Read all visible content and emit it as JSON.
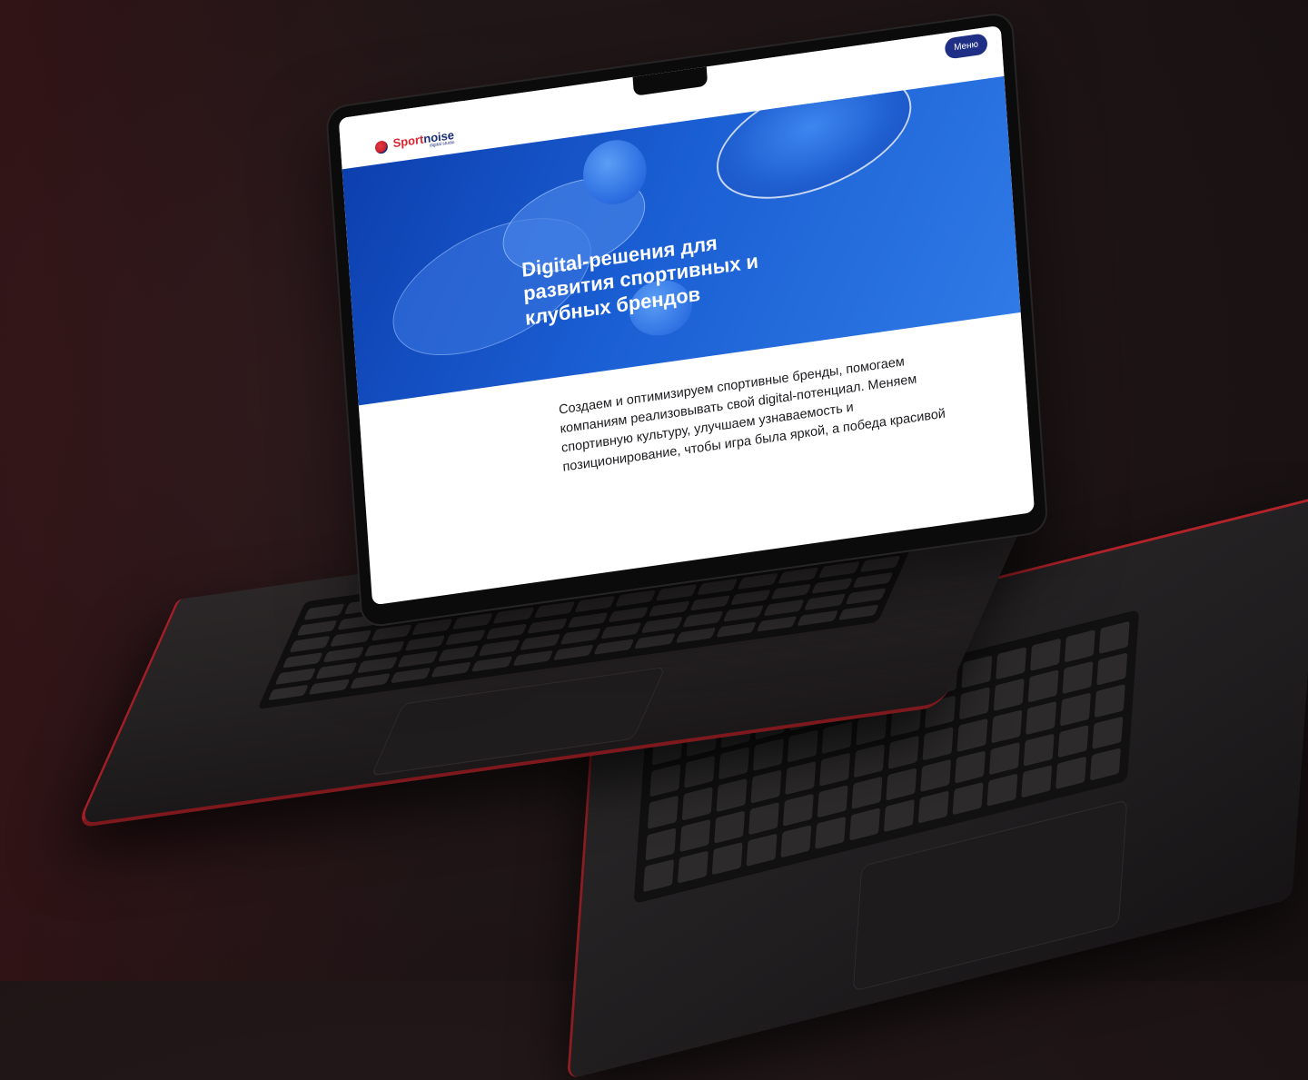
{
  "site": {
    "logo": {
      "name_part1": "Sport",
      "name_part2": "noise",
      "subtitle": "digital studio"
    },
    "header": {
      "menu_label": "Меню"
    },
    "hero": {
      "title": "Digital-решения для развития спортивных и клубных брендов"
    },
    "intro": {
      "text": "Создаем и оптимизируем спортивные бренды, помогаем компаниям реализовывать свой digital-потенциал. Меняем спортивную культуру, улучшаем узнаваемость и позиционирование, чтобы игра была яркой, а победа красивой"
    }
  },
  "colors": {
    "brand_red": "#d8242f",
    "brand_navy": "#1a2a7a",
    "menu_button": "#1f2f86",
    "hero_blue": "#1a5ed3",
    "laptop_accent": "#b2232a"
  }
}
